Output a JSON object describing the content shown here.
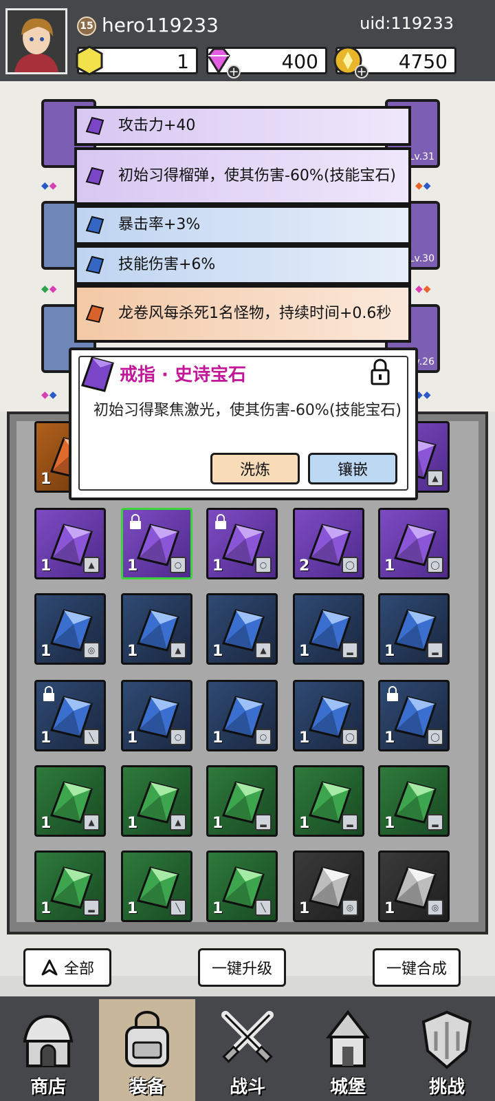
{
  "header": {
    "level": "15",
    "username": "hero119233",
    "uid": "uid:119233",
    "resources": [
      {
        "name": "gold-block",
        "value": "1",
        "color": "#f3e14c"
      },
      {
        "name": "gem",
        "value": "400",
        "color": "#e35ee0"
      },
      {
        "name": "coin",
        "value": "4750",
        "color": "#e9b629"
      }
    ]
  },
  "side_levels": {
    "right_top": "Lv.31",
    "right_mid": "Lv.30",
    "right_bottom": "Lv.26"
  },
  "stats": [
    {
      "text": "攻击力+40",
      "tier": "purple"
    },
    {
      "text": "初始习得榴弹，使其伤害-60%(技能宝石)",
      "tier": "purple"
    },
    {
      "text": "暴击率+3%",
      "tier": "blue"
    },
    {
      "text": "技能伤害+6%",
      "tier": "blue"
    },
    {
      "text": "龙卷风每杀死1名怪物，持续时间+0.6秒",
      "tier": "orange"
    }
  ],
  "popup": {
    "title": "戒指 · 史诗宝石",
    "description": "初始习得聚焦激光，使其伤害-60%(技能宝石)",
    "refine_label": "洗炼",
    "inlay_label": "镶嵌"
  },
  "grid": {
    "rows": [
      [
        {
          "tier": "orange",
          "count": "1"
        },
        {
          "tier": "hidden"
        },
        {
          "tier": "hidden"
        },
        {
          "tier": "hidden"
        },
        {
          "tier": "purple",
          "count": "",
          "slot": "armor"
        }
      ],
      [
        {
          "tier": "purple",
          "count": "1",
          "slot": "armor"
        },
        {
          "tier": "purple",
          "count": "1",
          "slot": "ring",
          "locked": true,
          "selected": true
        },
        {
          "tier": "purple",
          "count": "1",
          "slot": "ring",
          "locked": true
        },
        {
          "tier": "purple",
          "count": "2",
          "slot": "necklace"
        },
        {
          "tier": "purple",
          "count": "1",
          "slot": "necklace"
        }
      ],
      [
        {
          "tier": "blue",
          "count": "1",
          "slot": "bracer"
        },
        {
          "tier": "blue",
          "count": "1",
          "slot": "armor"
        },
        {
          "tier": "blue",
          "count": "1",
          "slot": "armor"
        },
        {
          "tier": "blue",
          "count": "1",
          "slot": "boots"
        },
        {
          "tier": "blue",
          "count": "1",
          "slot": "boots"
        }
      ],
      [
        {
          "tier": "blue",
          "count": "1",
          "slot": "weapon",
          "locked": true
        },
        {
          "tier": "blue",
          "count": "1",
          "slot": "ring"
        },
        {
          "tier": "blue",
          "count": "1",
          "slot": "ring"
        },
        {
          "tier": "blue",
          "count": "1",
          "slot": "necklace"
        },
        {
          "tier": "blue",
          "count": "1",
          "slot": "necklace",
          "locked": true
        }
      ],
      [
        {
          "tier": "green",
          "count": "1",
          "slot": "armor"
        },
        {
          "tier": "green",
          "count": "1",
          "slot": "armor"
        },
        {
          "tier": "green",
          "count": "1",
          "slot": "boots"
        },
        {
          "tier": "green",
          "count": "1",
          "slot": "boots"
        },
        {
          "tier": "green",
          "count": "1",
          "slot": "boots"
        }
      ],
      [
        {
          "tier": "green",
          "count": "1",
          "slot": "boots"
        },
        {
          "tier": "green",
          "count": "1",
          "slot": "weapon"
        },
        {
          "tier": "green",
          "count": "1",
          "slot": "weapon"
        },
        {
          "tier": "gray",
          "count": "1",
          "slot": "bracer"
        },
        {
          "tier": "gray",
          "count": "1",
          "slot": "bracer"
        }
      ]
    ]
  },
  "actions": {
    "filter_label": "全部",
    "upgrade_all_label": "一键升级",
    "merge_all_label": "一键合成"
  },
  "nav": [
    {
      "label": "商店",
      "icon": "shop-icon",
      "active": false
    },
    {
      "label": "装备",
      "icon": "backpack-icon",
      "active": true
    },
    {
      "label": "战斗",
      "icon": "crossed-swords-icon",
      "active": false
    },
    {
      "label": "城堡",
      "icon": "castle-icon",
      "active": false
    },
    {
      "label": "挑战",
      "icon": "shield-icon",
      "active": false
    }
  ],
  "tier_colors": {
    "purple": "#6b3fb0",
    "blue": "#22344f",
    "green": "#1f5a2b",
    "gray": "#2e2e2e",
    "orange": "#8d4a12"
  }
}
